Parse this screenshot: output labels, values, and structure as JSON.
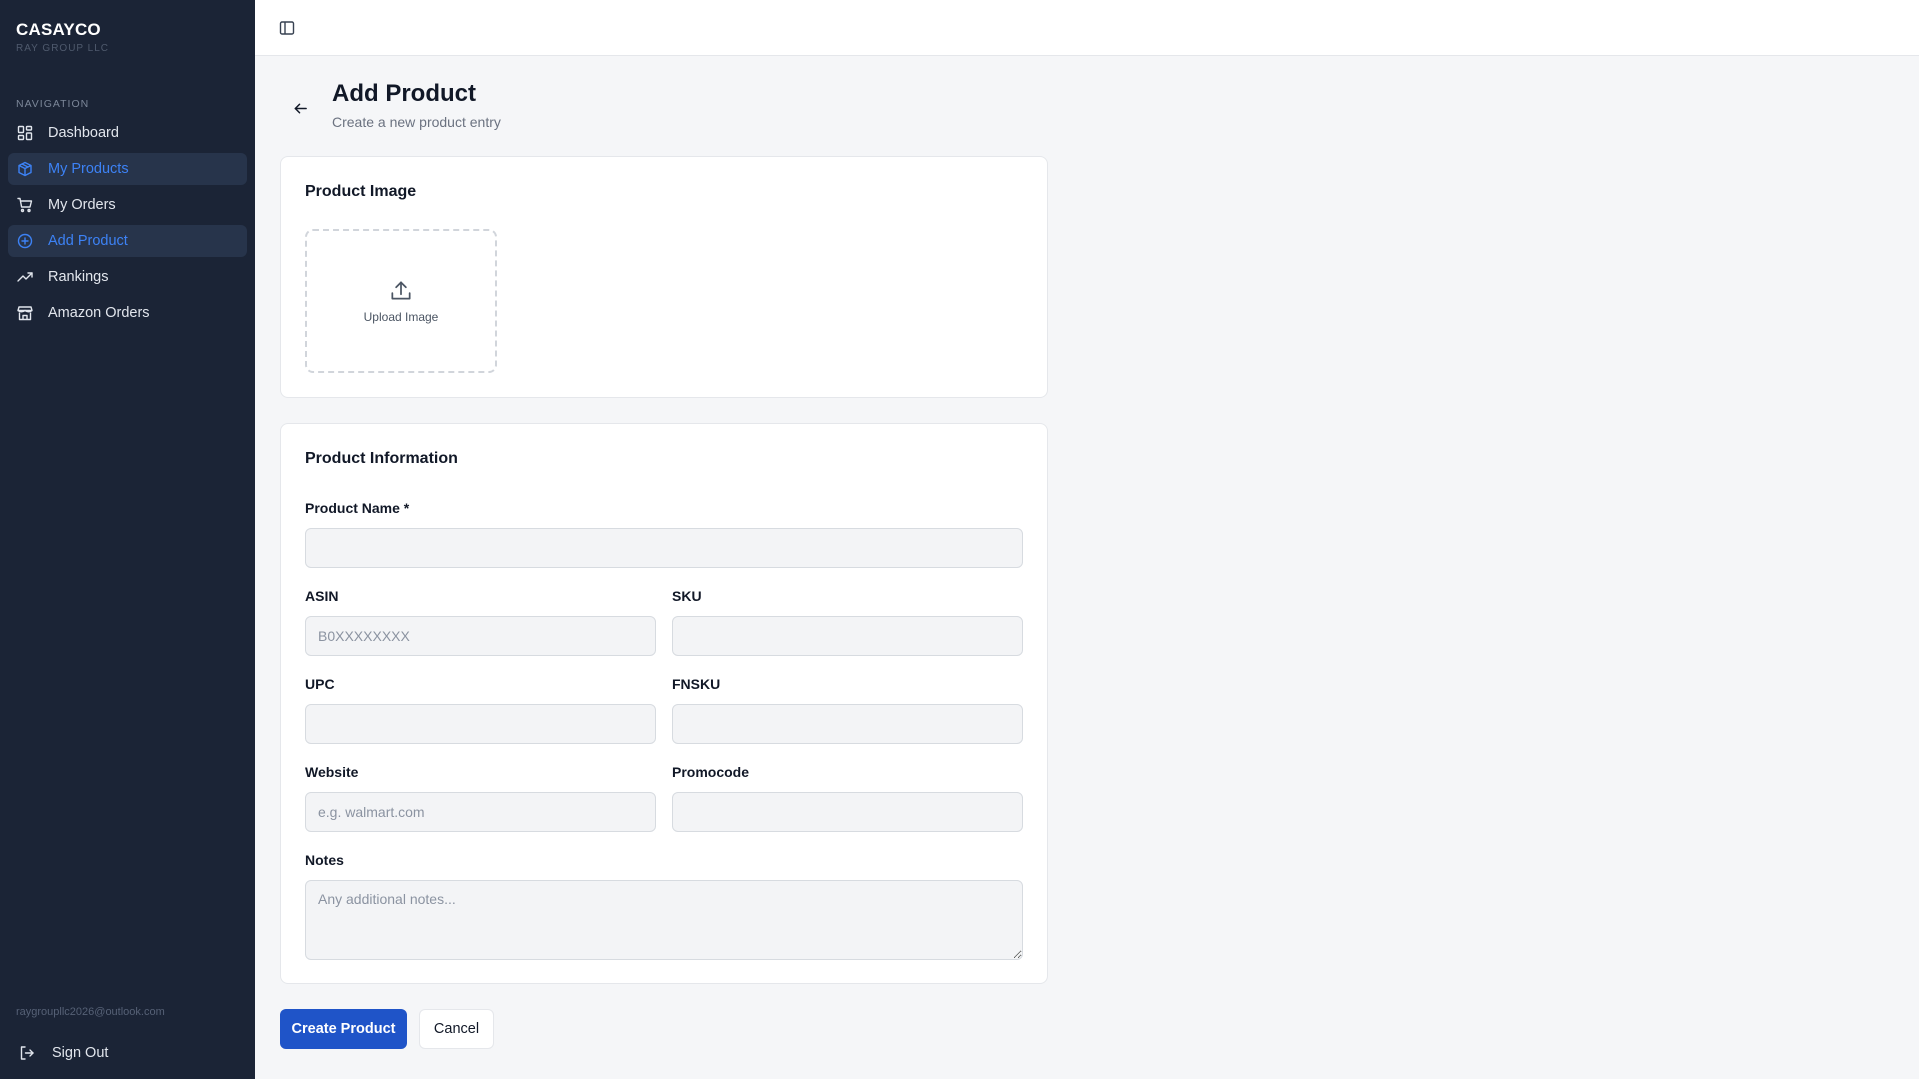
{
  "brand": {
    "name": "CASAYCO",
    "subtitle": "RAY GROUP LLC"
  },
  "sidebar": {
    "heading": "NAVIGATION",
    "items": [
      {
        "label": "Dashboard",
        "icon": "dashboard-grid-icon",
        "active": false
      },
      {
        "label": "My Products",
        "icon": "package-icon",
        "active": true
      },
      {
        "label": "My Orders",
        "icon": "cart-icon",
        "active": false
      },
      {
        "label": "Add Product",
        "icon": "plus-circle-icon",
        "active": true
      },
      {
        "label": "Rankings",
        "icon": "trending-up-icon",
        "active": false
      },
      {
        "label": "Amazon Orders",
        "icon": "store-icon",
        "active": false
      }
    ],
    "user_email": "raygroupllc2026@outlook.com",
    "signout_label": "Sign Out"
  },
  "header": {
    "title": "Add Product",
    "subtitle": "Create a new product entry"
  },
  "image_card": {
    "title": "Product Image",
    "upload_label": "Upload Image"
  },
  "info_card": {
    "title": "Product Information",
    "fields": {
      "product_name": {
        "label": "Product Name *",
        "placeholder": "",
        "value": ""
      },
      "asin": {
        "label": "ASIN",
        "placeholder": "B0XXXXXXXX",
        "value": ""
      },
      "sku": {
        "label": "SKU",
        "placeholder": "",
        "value": ""
      },
      "upc": {
        "label": "UPC",
        "placeholder": "",
        "value": ""
      },
      "fnsku": {
        "label": "FNSKU",
        "placeholder": "",
        "value": ""
      },
      "website": {
        "label": "Website",
        "placeholder": "e.g. walmart.com",
        "value": ""
      },
      "promocode": {
        "label": "Promocode",
        "placeholder": "",
        "value": ""
      },
      "notes": {
        "label": "Notes",
        "placeholder": "Any additional notes...",
        "value": ""
      }
    }
  },
  "actions": {
    "create_label": "Create Product",
    "cancel_label": "Cancel"
  },
  "colors": {
    "sidebar_bg": "#1b2436",
    "active_text": "#3d82f5",
    "primary_button": "#1f54c8",
    "page_bg": "#f5f6f8"
  }
}
